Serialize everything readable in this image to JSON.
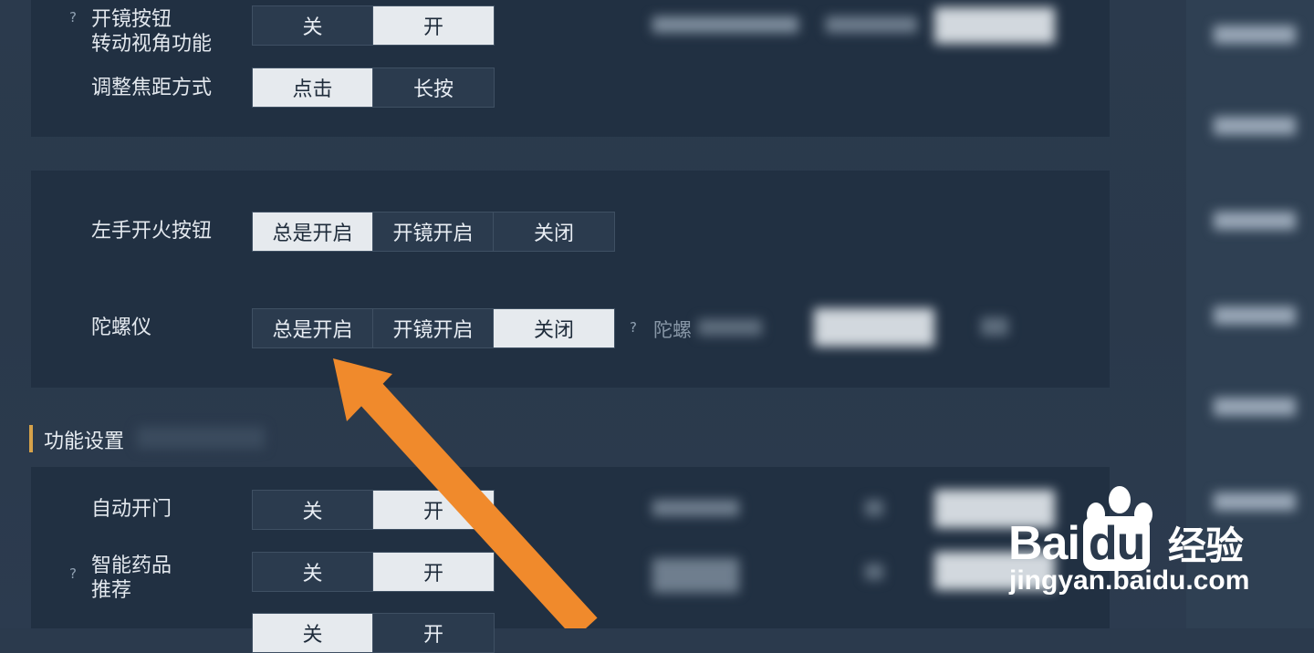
{
  "rows": {
    "scope_rotate": {
      "help": "?",
      "label_line1": "开镜按钮",
      "label_line2": "转动视角功能",
      "options": [
        "关",
        "开"
      ],
      "selected": "开"
    },
    "zoom_mode": {
      "label": "调整焦距方式",
      "options": [
        "点击",
        "长按"
      ],
      "selected": "点击"
    },
    "left_fire": {
      "label": "左手开火按钮",
      "options": [
        "总是开启",
        "开镜开启",
        "关闭"
      ],
      "selected": "总是开启"
    },
    "gyroscope": {
      "label": "陀螺仪",
      "options": [
        "总是开启",
        "开镜开启",
        "关闭"
      ],
      "selected": "关闭",
      "help": "?",
      "side_label": "陀螺"
    },
    "auto_door": {
      "label": "自动开门",
      "options": [
        "关",
        "开"
      ],
      "selected": "开"
    },
    "smart_medicine": {
      "help": "?",
      "label_line1": "智能药品",
      "label_line2": "推荐",
      "options": [
        "关",
        "开"
      ],
      "selected": "开"
    },
    "cut_row": {
      "options": [
        "关",
        "开"
      ]
    }
  },
  "section": {
    "title": "功能设置"
  },
  "watermark": {
    "brand": "Bai",
    "brand2": "du",
    "suffix": "经验",
    "url": "jingyan.baidu.com"
  },
  "colors": {
    "accent": "#f08a2c",
    "selected_bg": "#e6eaee",
    "section_bar": "#d6a24a"
  }
}
